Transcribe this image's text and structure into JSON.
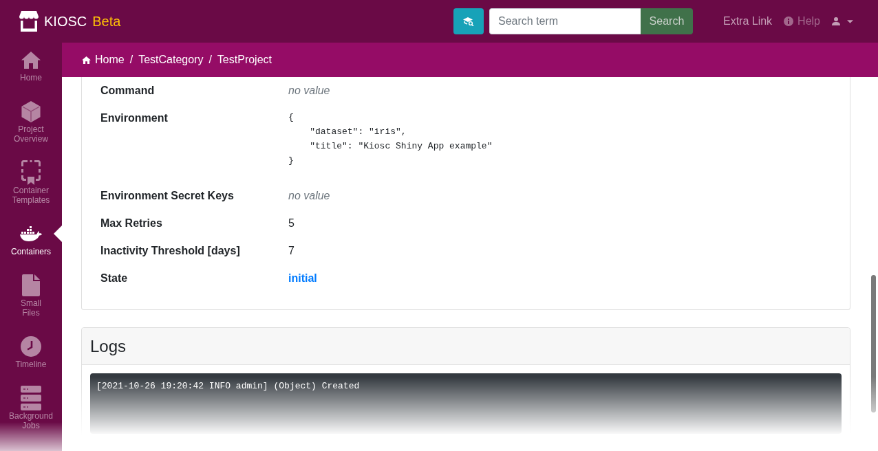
{
  "navbar": {
    "brand": {
      "name": "KIOSC",
      "tag": "Beta"
    },
    "search": {
      "placeholder": "Search term",
      "button": "Search"
    },
    "links": [
      {
        "label": "Extra Link",
        "kind": "link",
        "disabled": false
      },
      {
        "label": "Help",
        "kind": "help",
        "disabled": true
      }
    ]
  },
  "sidebar": {
    "items": [
      {
        "label": "Home",
        "kind": "home",
        "selected": false
      },
      {
        "label": "Project\nOverview",
        "kind": "overview",
        "selected": false
      },
      {
        "label": "Container\nTemplates",
        "kind": "templates",
        "selected": false
      },
      {
        "label": "Containers",
        "kind": "containers",
        "selected": true
      },
      {
        "label": "Small\nFiles",
        "kind": "files",
        "selected": false
      },
      {
        "label": "Timeline",
        "kind": "timeline",
        "selected": false
      },
      {
        "label": "Background\nJobs",
        "kind": "jobs",
        "selected": false
      }
    ]
  },
  "breadcrumb": {
    "separator": "/",
    "items": [
      {
        "label": "Home"
      },
      {
        "label": "TestCategory"
      },
      {
        "label": "TestProject"
      }
    ]
  },
  "details": {
    "rows": [
      {
        "label": "Command",
        "kind": "empty",
        "value": "no value"
      },
      {
        "label": "Environment",
        "kind": "code",
        "value": "{\n    \"dataset\": \"iris\",\n    \"title\": \"Kiosc Shiny App example\"\n}"
      },
      {
        "label": "Environment Secret Keys",
        "kind": "empty",
        "value": "no value"
      },
      {
        "label": "Max Retries",
        "kind": "text",
        "value": "5"
      },
      {
        "label": "Inactivity Threshold [days]",
        "kind": "text",
        "value": "7"
      },
      {
        "label": "State",
        "kind": "state",
        "value": "initial"
      }
    ]
  },
  "logs": {
    "title": "Logs",
    "lines": [
      "[2021-10-26 19:20:42 INFO admin] (Object) Created"
    ]
  }
}
